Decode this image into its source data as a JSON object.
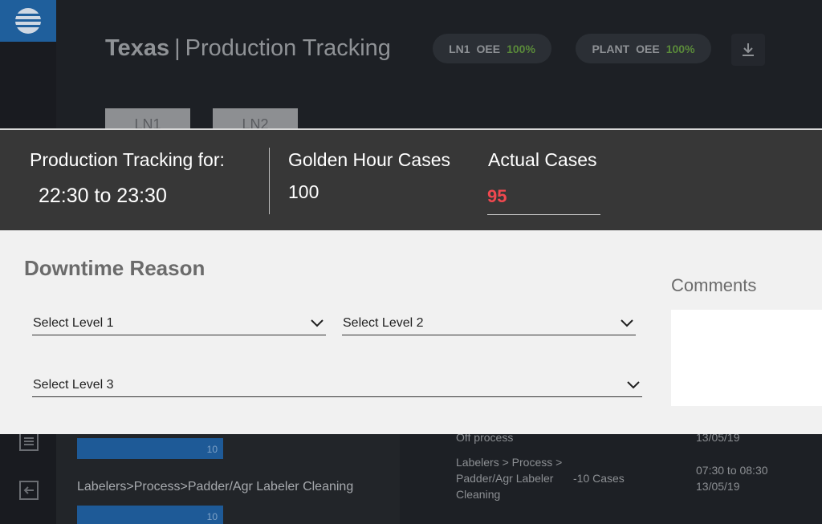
{
  "header": {
    "site": "Texas",
    "separator": "|",
    "page": "Production Tracking",
    "pills": [
      {
        "line": "LN1",
        "metric": "OEE",
        "value": "100%"
      },
      {
        "line": "PLANT",
        "metric": "OEE",
        "value": "100%"
      }
    ],
    "tabs": [
      "LN1",
      "LN2"
    ]
  },
  "tracking": {
    "label": "Production Tracking for:",
    "period": "22:30 to 23:30",
    "golden_label": "Golden Hour Cases",
    "golden_value": "100",
    "actual_label": "Actual Cases",
    "actual_value": "95"
  },
  "downtime": {
    "title": "Downtime Reason",
    "level1": "Select Level 1",
    "level2": "Select Level 2",
    "level3": "Select Level 3",
    "comments_label": "Comments"
  },
  "background_list": {
    "bars": [
      "10",
      "10"
    ],
    "entry_path": "Labelers>Process>Padder/Agr Labeler Cleaning",
    "top_reason_fragment": "Off process",
    "top_date": "13/05/19",
    "reason_lines": [
      "Labelers > Process >",
      "Padder/Agr Labeler",
      "Cleaning"
    ],
    "cases": "-10 Cases",
    "time": "07:30 to 08:30",
    "date": "13/05/19"
  },
  "colors": {
    "accent_blue": "#1f5f9c",
    "actual_red": "#f0484f",
    "oee_green": "#5a8a3a"
  }
}
